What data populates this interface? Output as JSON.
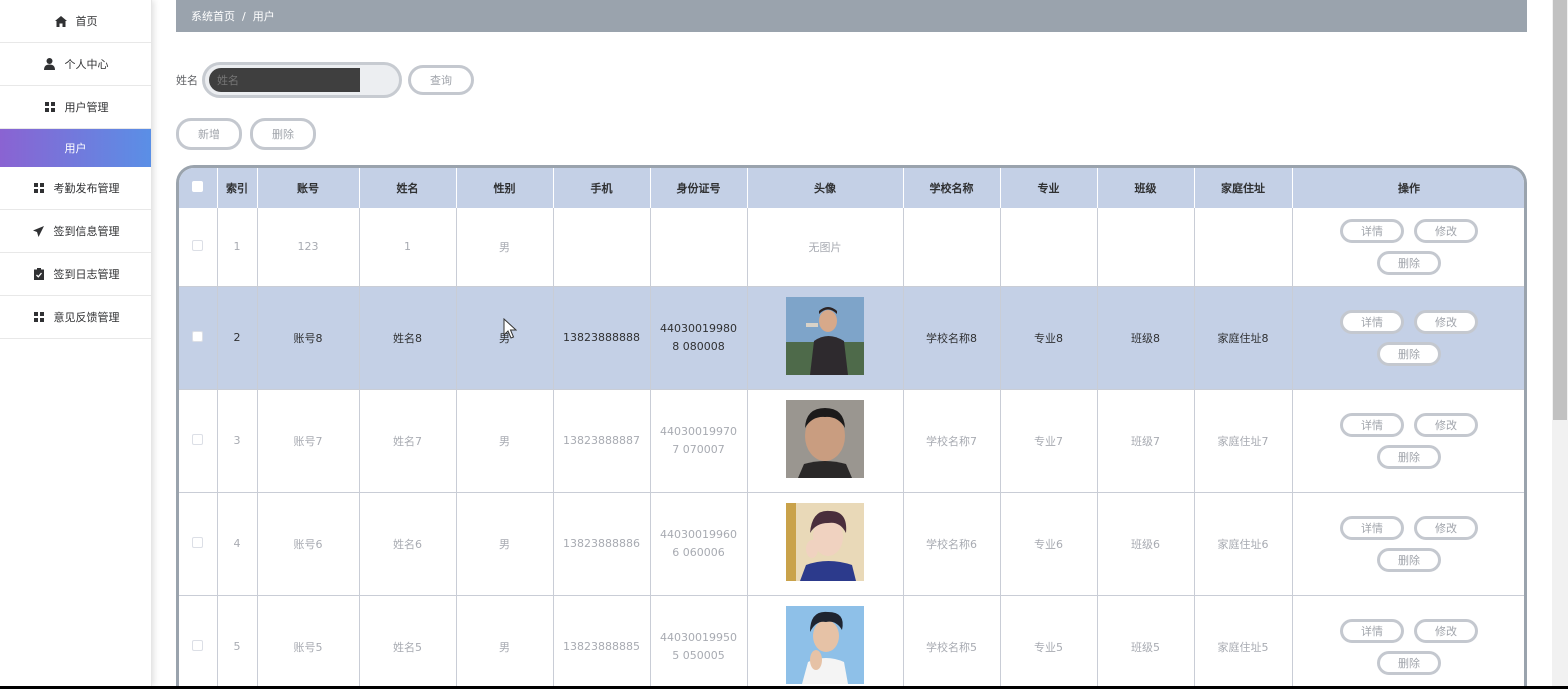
{
  "sidebar": {
    "items": [
      {
        "label": "首页",
        "icon": "home-icon"
      },
      {
        "label": "个人中心",
        "icon": "user-icon"
      },
      {
        "label": "用户管理",
        "icon": "grid-icon"
      },
      {
        "label": "用户",
        "icon": "",
        "active": true
      },
      {
        "label": "考勤发布管理",
        "icon": "grid-icon"
      },
      {
        "label": "签到信息管理",
        "icon": "send-icon"
      },
      {
        "label": "签到日志管理",
        "icon": "clipboard-icon"
      },
      {
        "label": "意见反馈管理",
        "icon": "grid-icon"
      }
    ]
  },
  "breadcrumb": {
    "home": "系统首页",
    "separator": "/",
    "current": "用户"
  },
  "search": {
    "label": "姓名",
    "value": "",
    "placeholder": "姓名",
    "button": "查询"
  },
  "actions": {
    "add": "新增",
    "delete": "删除"
  },
  "table": {
    "headers": [
      "",
      "索引",
      "账号",
      "姓名",
      "性别",
      "手机",
      "身份证号",
      "头像",
      "学校名称",
      "专业",
      "班级",
      "家庭住址",
      "操作"
    ],
    "op_labels": {
      "detail": "详情",
      "edit": "修改",
      "delete": "删除"
    },
    "no_image": "无图片",
    "rows": [
      {
        "index": "1",
        "account": "123",
        "name": "1",
        "gender": "男",
        "phone": "",
        "id_card": "",
        "avatar": "none",
        "school": "",
        "major": "",
        "class": "",
        "address": ""
      },
      {
        "index": "2",
        "account": "账号8",
        "name": "姓名8",
        "gender": "男",
        "phone": "13823888888",
        "id_card": "440300199808 080008",
        "avatar": "photo",
        "school": "学校名称8",
        "major": "专业8",
        "class": "班级8",
        "address": "家庭住址8",
        "selected": true
      },
      {
        "index": "3",
        "account": "账号7",
        "name": "姓名7",
        "gender": "男",
        "phone": "13823888887",
        "id_card": "440300199707 070007",
        "avatar": "photo",
        "school": "学校名称7",
        "major": "专业7",
        "class": "班级7",
        "address": "家庭住址7"
      },
      {
        "index": "4",
        "account": "账号6",
        "name": "姓名6",
        "gender": "男",
        "phone": "13823888886",
        "id_card": "440300199606 060006",
        "avatar": "photo",
        "school": "学校名称6",
        "major": "专业6",
        "class": "班级6",
        "address": "家庭住址6"
      },
      {
        "index": "5",
        "account": "账号5",
        "name": "姓名5",
        "gender": "男",
        "phone": "13823888885",
        "id_card": "440300199505 050005",
        "avatar": "photo",
        "school": "学校名称5",
        "major": "专业5",
        "class": "班级5",
        "address": "家庭住址5"
      }
    ]
  },
  "colors": {
    "accent_start": "#8a63d2",
    "accent_end": "#5a8fe6",
    "header_bg": "#c4d0e6",
    "breadcrumb_bg": "#9aa3ad"
  }
}
